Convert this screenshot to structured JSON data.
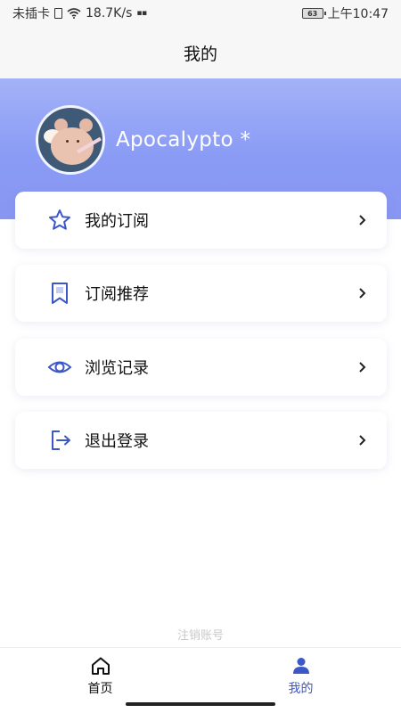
{
  "status_bar": {
    "carrier": "未插卡",
    "speed": "18.7K/s",
    "battery": "63",
    "time": "上午10:47"
  },
  "nav": {
    "title": "我的"
  },
  "profile": {
    "username": "Apocalypto *"
  },
  "menu": [
    {
      "label": "我的订阅",
      "icon": "star-icon"
    },
    {
      "label": "订阅推荐",
      "icon": "bookmark-icon"
    },
    {
      "label": "浏览记录",
      "icon": "eye-icon"
    },
    {
      "label": "退出登录",
      "icon": "logout-icon"
    }
  ],
  "footer": {
    "deactivate_label": "注销账号"
  },
  "tabs": [
    {
      "label": "首页",
      "icon": "home-icon",
      "active": false
    },
    {
      "label": "我的",
      "icon": "person-icon",
      "active": true
    }
  ],
  "colors": {
    "accent": "#3d57c8",
    "header_gradient_top": "#a3b2f7",
    "header_gradient_bottom": "#8796f2"
  }
}
